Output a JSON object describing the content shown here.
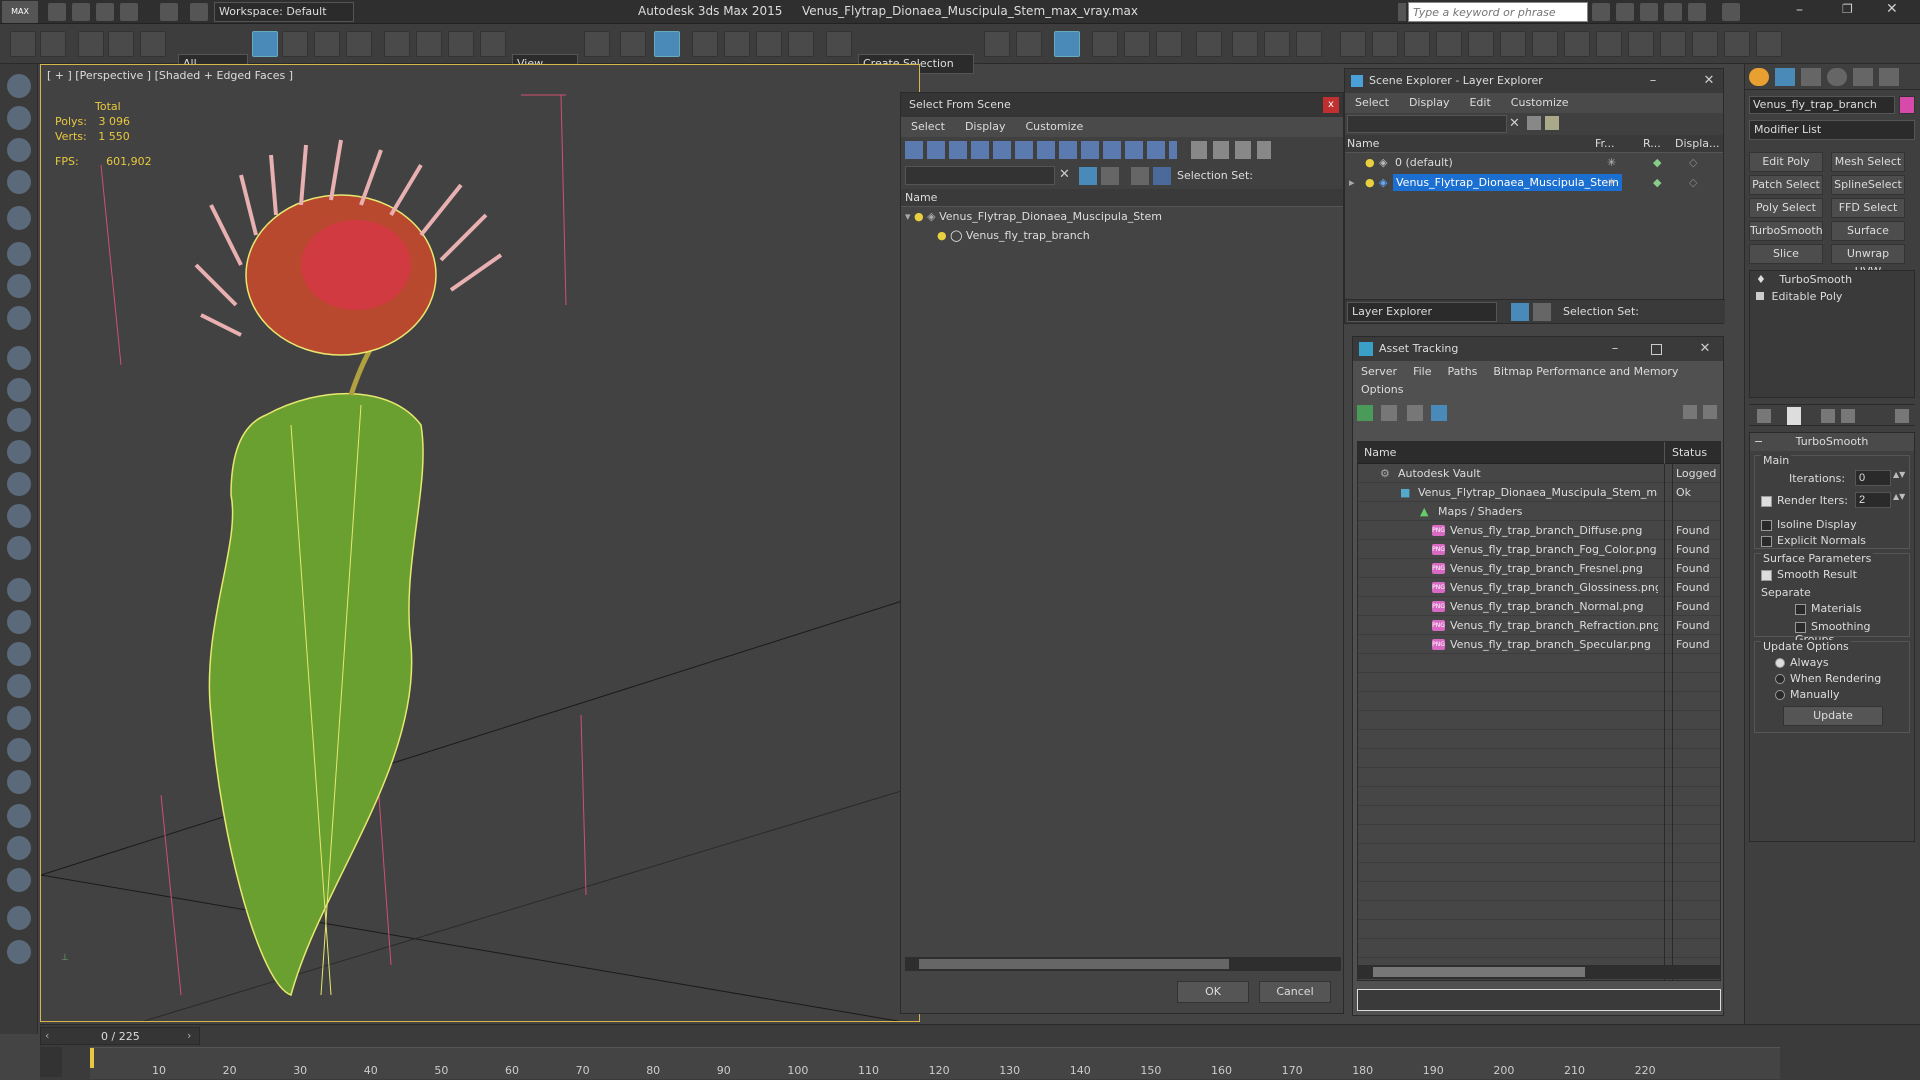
{
  "window": {
    "app": "Autodesk 3ds Max  2015",
    "file": "Venus_Flytrap_Dionaea_Muscipula_Stem_max_vray.max",
    "workspace": "Workspace: Default",
    "search_placeholder": "Type a keyword or phrase"
  },
  "toolbar": {
    "filter": "All",
    "ref_coord": "View",
    "named_selection": "Create Selection Se"
  },
  "viewport": {
    "label": "[ + ] [Perspective ] [Shaded + Edged Faces ]",
    "stats": {
      "total": "Total",
      "polys_label": "Polys:",
      "polys": "3 096",
      "verts_label": "Verts:",
      "verts": "1 550",
      "fps_label": "FPS:",
      "fps": "601,902"
    }
  },
  "select_dialog": {
    "title": "Select From Scene",
    "menu": [
      "Select",
      "Display",
      "Customize"
    ],
    "selection_set": "Selection Set:",
    "col_name": "Name",
    "items": [
      "Venus_Flytrap_Dionaea_Muscipula_Stem",
      "Venus_fly_trap_branch"
    ],
    "ok": "OK",
    "cancel": "Cancel"
  },
  "scene_explorer": {
    "title": "Scene Explorer - Layer Explorer",
    "menu": [
      "Select",
      "Display",
      "Edit",
      "Customize"
    ],
    "cols": [
      "Name",
      "Fr...",
      "R...",
      "Displa..."
    ],
    "layers": [
      "0 (default)",
      "Venus_Flytrap_Dionaea_Muscipula_Stem"
    ],
    "footer_label": "Layer Explorer",
    "selection_set": "Selection Set:"
  },
  "asset_tracking": {
    "title": "Asset Tracking",
    "menu": [
      "Server",
      "File",
      "Paths",
      "Bitmap Performance and Memory",
      "Options"
    ],
    "cols": [
      "Name",
      "Status"
    ],
    "rows": [
      {
        "name": "Autodesk Vault",
        "status": "Logged",
        "indent": 1
      },
      {
        "name": "Venus_Flytrap_Dionaea_Muscipula_Stem_ma...",
        "status": "Ok",
        "indent": 2
      },
      {
        "name": "Maps / Shaders",
        "status": "",
        "indent": 3
      },
      {
        "name": "Venus_fly_trap_branch_Diffuse.png",
        "status": "Found",
        "indent": 4
      },
      {
        "name": "Venus_fly_trap_branch_Fog_Color.png",
        "status": "Found",
        "indent": 4
      },
      {
        "name": "Venus_fly_trap_branch_Fresnel.png",
        "status": "Found",
        "indent": 4
      },
      {
        "name": "Venus_fly_trap_branch_Glossiness.png",
        "status": "Found",
        "indent": 4
      },
      {
        "name": "Venus_fly_trap_branch_Normal.png",
        "status": "Found",
        "indent": 4
      },
      {
        "name": "Venus_fly_trap_branch_Refraction.png",
        "status": "Found",
        "indent": 4
      },
      {
        "name": "Venus_fly_trap_branch_Specular.png",
        "status": "Found",
        "indent": 4
      }
    ]
  },
  "command_panel": {
    "object_name": "Venus_fly_trap_branch",
    "modifier_list": "Modifier List",
    "mod_buttons": [
      "Edit Poly",
      "Mesh Select",
      "Patch Select",
      "SplineSelect",
      "Poly Select",
      "FFD Select",
      "TurboSmooth",
      "Surface Select",
      "Slice",
      "Unwrap UVW"
    ],
    "stack": [
      "TurboSmooth",
      "Editable Poly"
    ],
    "rollout": "TurboSmooth",
    "main": "Main",
    "iterations_label": "Iterations:",
    "iterations": "0",
    "render_iters_label": "Render Iters:",
    "render_iters": "2",
    "isoline": "Isoline Display",
    "explicit": "Explicit Normals",
    "surface_params": "Surface Parameters",
    "smooth_result": "Smooth Result",
    "separate": "Separate",
    "materials": "Materials",
    "smoothing_groups": "Smoothing Groups",
    "update_options": "Update Options",
    "always": "Always",
    "when_rendering": "When Rendering",
    "manually": "Manually",
    "update": "Update"
  },
  "timeline": {
    "frame": "0 / 225",
    "ticks": [
      "10",
      "20",
      "30",
      "40",
      "50",
      "60",
      "70",
      "80",
      "90",
      "100",
      "110",
      "120",
      "130",
      "140",
      "150",
      "160",
      "170",
      "180",
      "190",
      "200",
      "210",
      "220"
    ]
  },
  "colors": {
    "accent": "#4a8ab8",
    "viewport_border": "#d8b74a",
    "selection": "#1a6fd0"
  }
}
